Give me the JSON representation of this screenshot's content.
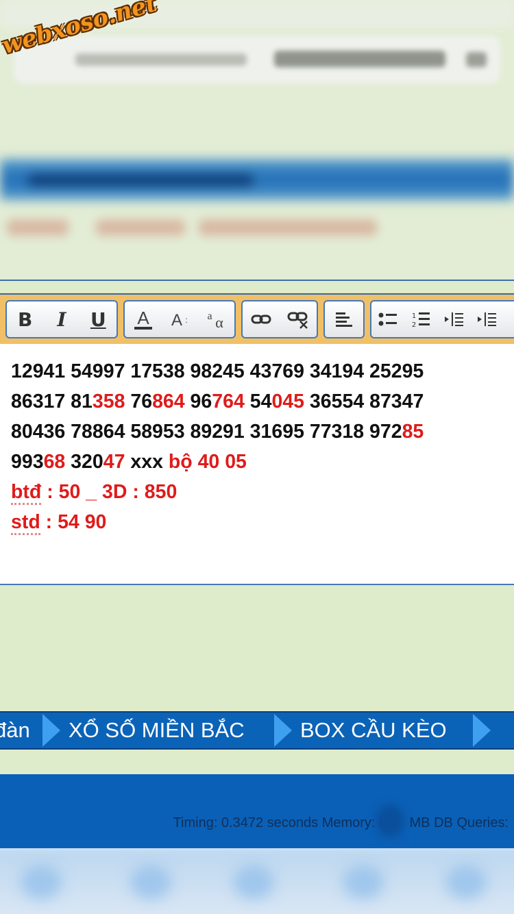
{
  "watermark": "webxoso.net",
  "toolbar": {
    "bold_label": "B",
    "italic_label": "I",
    "underline_label": "U",
    "font_color_label": "A",
    "font_size_label": "A↕",
    "font_family_label": "aα"
  },
  "editor": {
    "lines": [
      [
        {
          "t": "12941 54997 17538 98245 43769 34194 25295",
          "red": false
        }
      ],
      [
        {
          "t": "86317 81",
          "red": false
        },
        {
          "t": "358",
          "red": true
        },
        {
          "t": " 76",
          "red": false
        },
        {
          "t": "864",
          "red": true
        },
        {
          "t": " 96",
          "red": false
        },
        {
          "t": "764",
          "red": true
        },
        {
          "t": " 54",
          "red": false
        },
        {
          "t": "045",
          "red": true
        },
        {
          "t": " 36554 87347",
          "red": false
        }
      ],
      [
        {
          "t": "80436 78864 58953 89291 31695 77318 972",
          "red": false
        },
        {
          "t": "85",
          "red": true
        }
      ],
      [
        {
          "t": "993",
          "red": false
        },
        {
          "t": "68",
          "red": true
        },
        {
          "t": " 320",
          "red": false
        },
        {
          "t": "47",
          "red": true
        },
        {
          "t": " xxx ",
          "red": false
        },
        {
          "t": "bộ 40 05",
          "red": true
        }
      ],
      [
        {
          "t": "btđ",
          "red": true,
          "sq": true
        },
        {
          "t": " : 50 _ 3D : 850",
          "red": true
        }
      ],
      [
        {
          "t": "std",
          "red": true,
          "sq": true
        },
        {
          "t": " : 54 90",
          "red": true
        }
      ]
    ]
  },
  "nav": {
    "items": [
      "đàn",
      "XỔ SỐ MIỀN BẮC",
      "BOX CẦU KÈO"
    ]
  },
  "footer": {
    "timing": "Timing: 0.3472 seconds Memory: 8.4   MB DB Queries:"
  }
}
